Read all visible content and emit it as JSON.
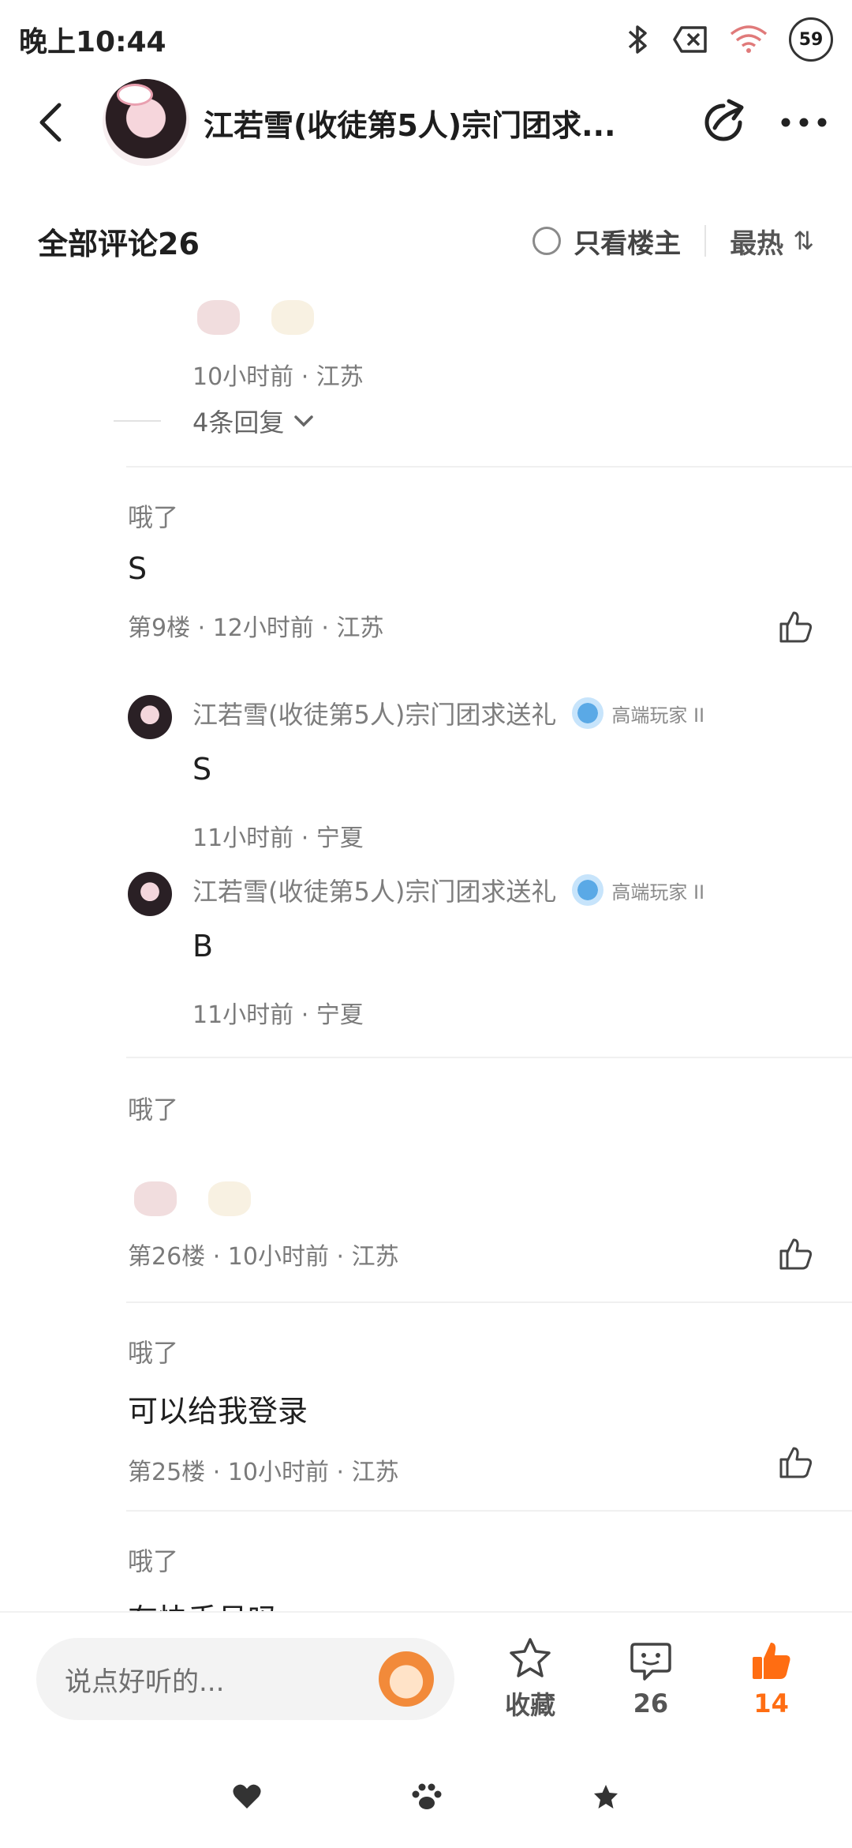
{
  "status": {
    "time": "晚上10:44",
    "battery": "59"
  },
  "header": {
    "title": "江若雪(收徒第5人)宗门团求..."
  },
  "filter": {
    "all_comments": "全部评论26",
    "only_op": "只看楼主",
    "sort": "最热",
    "sort_icon": "⇅"
  },
  "top_fragment": {
    "meta": "10小时前 · 江苏",
    "replies_label": "4条回复"
  },
  "comments": [
    {
      "user": "哦了",
      "text": "S",
      "meta": "第9楼 · 12小时前 · 江苏",
      "replies": [
        {
          "user": "江若雪(收徒第5人)宗门团求送礼",
          "badge": "高端玩家 II",
          "text": "S",
          "meta": "11小时前 · 宁夏"
        },
        {
          "user": "江若雪(收徒第5人)宗门团求送礼",
          "badge": "高端玩家 II",
          "text": "B",
          "meta": "11小时前 · 宁夏"
        }
      ]
    },
    {
      "user": "哦了",
      "meta": "第26楼 · 10小时前 · 江苏"
    },
    {
      "user": "哦了",
      "text": "可以给我登录",
      "meta": "第25楼 · 10小时前 · 江苏"
    },
    {
      "user": "哦了",
      "text": "有快手号吗"
    }
  ],
  "actionbar": {
    "placeholder": "说点好听的...",
    "collect_label": "收藏",
    "comment_count": "26",
    "like_count": "14"
  },
  "colors": {
    "accent": "#ff6d12",
    "text_secondary": "#7a7a7a"
  }
}
